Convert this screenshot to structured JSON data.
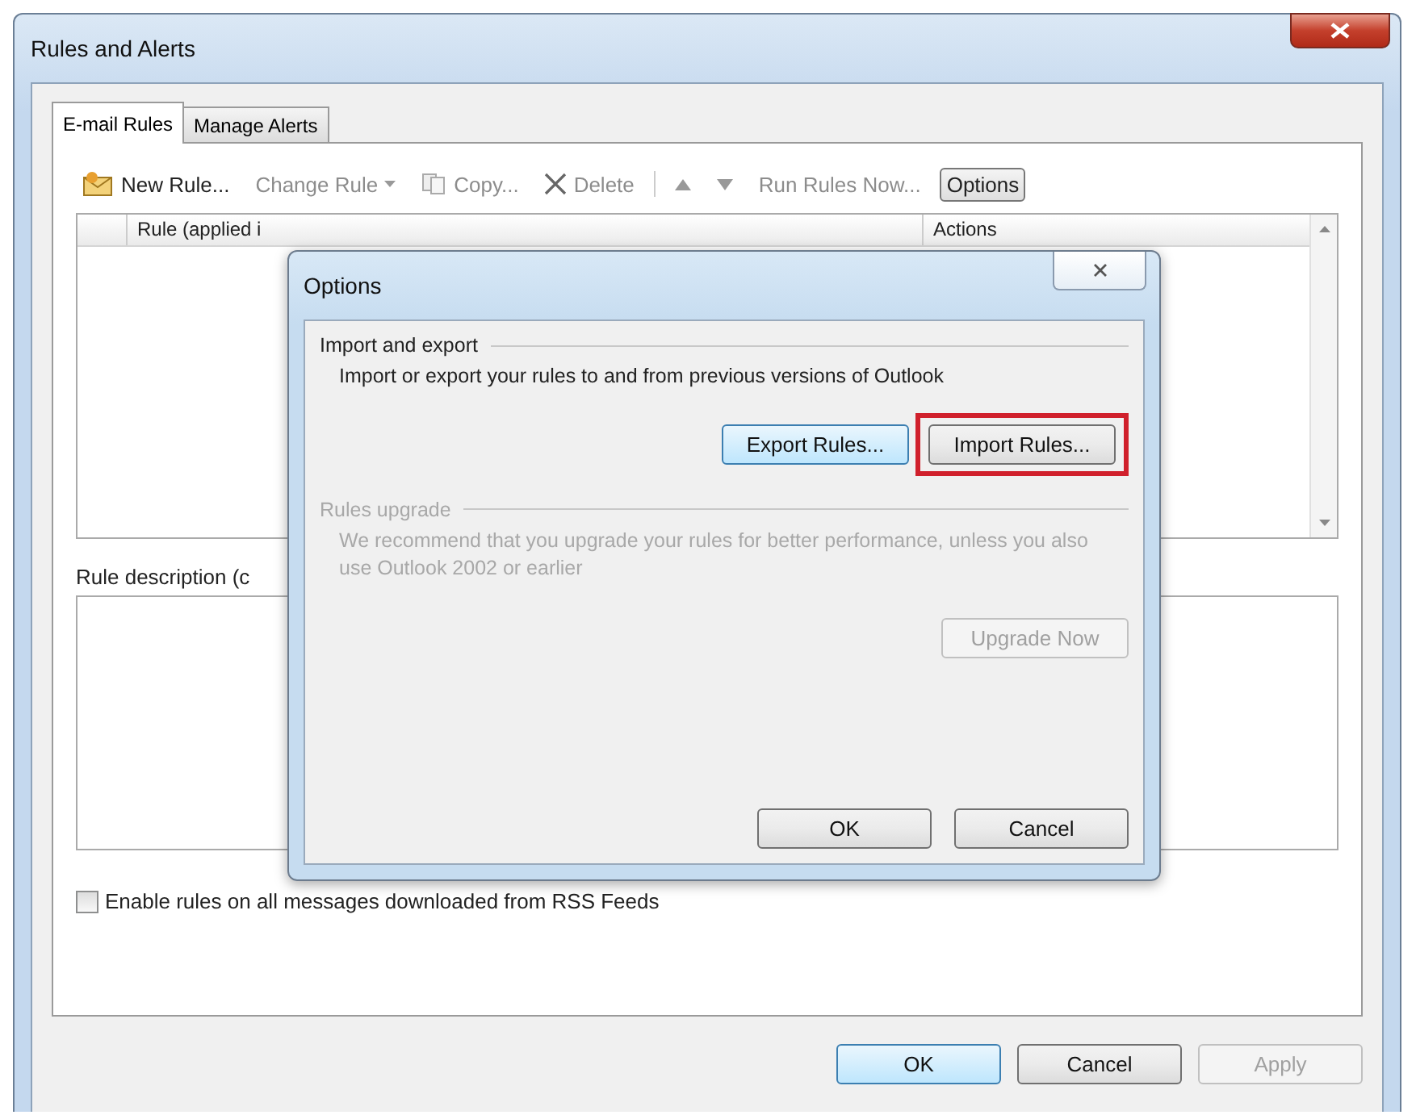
{
  "window": {
    "title": "Rules and Alerts"
  },
  "tabs": [
    {
      "label": "E-mail Rules",
      "selected": true
    },
    {
      "label": "Manage Alerts",
      "selected": false
    }
  ],
  "toolbar": [
    {
      "kind": "envelope",
      "label": "New Rule...",
      "disabled": false,
      "pressed": false
    },
    {
      "kind": "dropdown",
      "label": "Change Rule",
      "disabled": true,
      "pressed": false
    },
    {
      "kind": "copy",
      "label": "Copy...",
      "disabled": true,
      "pressed": false
    },
    {
      "kind": "delete",
      "label": "Delete",
      "disabled": true,
      "pressed": false
    },
    {
      "kind": "separator"
    },
    {
      "kind": "up",
      "disabled": true,
      "pressed": false
    },
    {
      "kind": "down",
      "disabled": true,
      "pressed": false
    },
    {
      "kind": "text",
      "label": "Run Rules Now...",
      "disabled": true,
      "pressed": false
    },
    {
      "kind": "text",
      "label": "Options",
      "disabled": false,
      "pressed": true
    }
  ],
  "rules_table": {
    "columns": [
      "Rule (applied i",
      "Actions"
    ]
  },
  "description_label": "Rule description (c",
  "rss_checkbox": {
    "label": "Enable rules on all messages downloaded from RSS Feeds",
    "checked": false
  },
  "buttons": [
    {
      "label": "OK",
      "default": true,
      "disabled": false
    },
    {
      "label": "Cancel",
      "default": false,
      "disabled": false
    },
    {
      "label": "Apply",
      "default": false,
      "disabled": true
    }
  ],
  "dialog": {
    "title": "Options",
    "sections": [
      {
        "heading": "Import and export",
        "text": "Import or export your rules to and from previous versions of Outlook",
        "disabled": false,
        "buttons": [
          {
            "label": "Export Rules...",
            "default": true,
            "disabled": false,
            "highlighted": false
          },
          {
            "label": "Import Rules...",
            "default": false,
            "disabled": false,
            "highlighted": true
          }
        ]
      },
      {
        "heading": "Rules upgrade",
        "text": "We recommend that you upgrade your rules for better performance, unless you also use Outlook 2002 or earlier",
        "disabled": true,
        "buttons": [
          {
            "label": "Upgrade Now",
            "default": false,
            "disabled": true,
            "highlighted": false
          }
        ]
      }
    ],
    "buttons": [
      {
        "label": "OK",
        "default": false,
        "disabled": false
      },
      {
        "label": "Cancel",
        "default": false,
        "disabled": false
      }
    ]
  }
}
